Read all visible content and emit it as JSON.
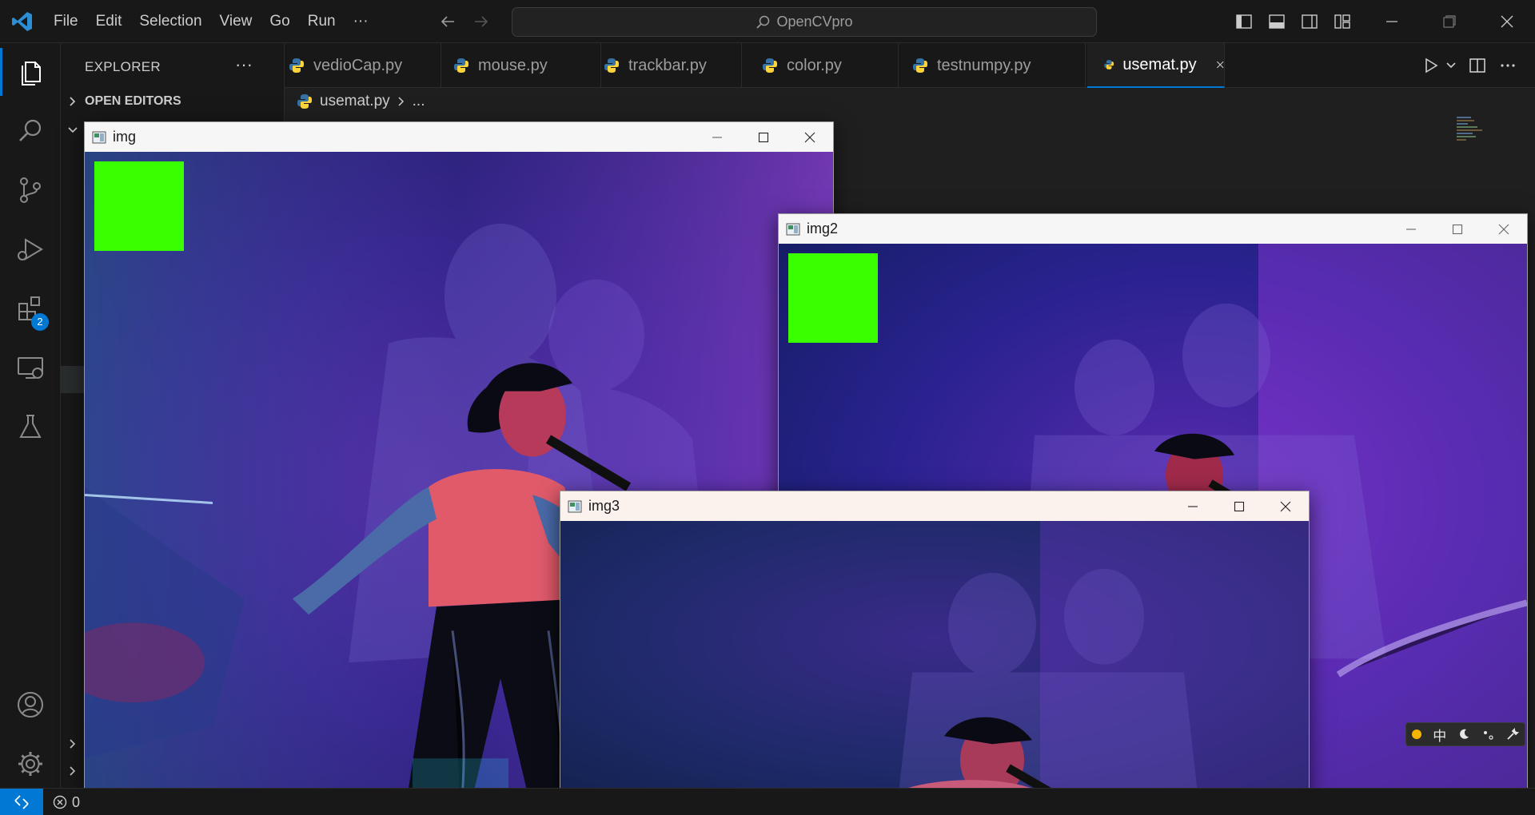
{
  "titlebar": {
    "menu": [
      "File",
      "Edit",
      "Selection",
      "View",
      "Go",
      "Run",
      "···"
    ],
    "search_text": "OpenCVpro"
  },
  "activity": {
    "extensions_badge": "2"
  },
  "sidebar": {
    "title": "EXPLORER",
    "more": "···",
    "open_editors": "OPEN EDITORS"
  },
  "tabs": [
    {
      "label": "vedioCap.py"
    },
    {
      "label": "mouse.py"
    },
    {
      "label": "trackbar.py"
    },
    {
      "label": "color.py"
    },
    {
      "label": "testnumpy.py"
    },
    {
      "label": "usemat.py",
      "active": true
    }
  ],
  "breadcrumb": {
    "file": "usemat.py",
    "more": "..."
  },
  "windows": {
    "img": {
      "title": "img"
    },
    "img2": {
      "title": "img2"
    },
    "img3": {
      "title": "img3"
    }
  },
  "statusbar": {
    "errors": "0"
  },
  "ime": {
    "lang": "中"
  },
  "colors": {
    "accent": "#0078d4",
    "green_box": "#39ff00",
    "python_blue": "#3572a5",
    "python_yellow": "#ffd43b"
  },
  "icons": [
    "vscode-logo",
    "back-arrow-icon",
    "forward-arrow-icon",
    "search-icon",
    "files-icon",
    "source-control-icon",
    "run-debug-icon",
    "extensions-icon",
    "remote-explorer-icon",
    "testing-icon",
    "account-icon",
    "gear-icon",
    "play-icon",
    "split-editor-icon",
    "python-file-icon",
    "close-icon",
    "minimize-icon",
    "maximize-icon",
    "remote-icon",
    "error-icon"
  ]
}
